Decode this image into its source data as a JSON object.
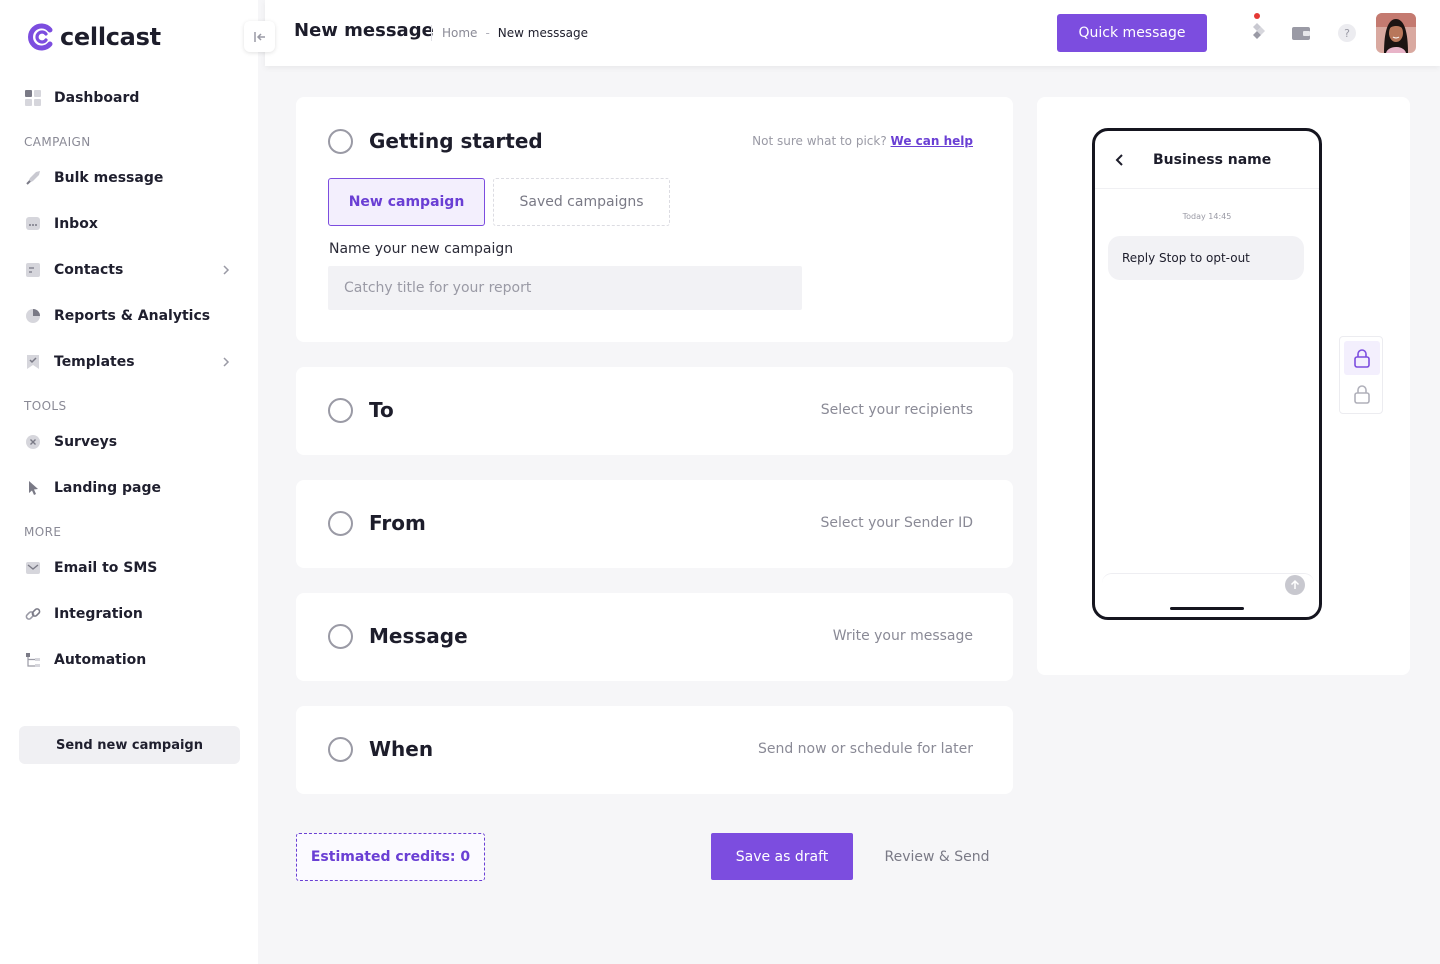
{
  "brand": {
    "name": "cellcast",
    "accent": "#7c4ddf"
  },
  "sidebar": {
    "dashboard": "Dashboard",
    "sections": {
      "campaign": "CAMPAIGN",
      "tools": "TOOLS",
      "more": "MORE"
    },
    "items": [
      {
        "label": "Bulk message",
        "icon": "rocket-icon"
      },
      {
        "label": "Inbox",
        "icon": "inbox-icon"
      },
      {
        "label": "Contacts",
        "icon": "contacts-icon"
      },
      {
        "label": "Reports & Analytics",
        "icon": "pie-chart-icon"
      },
      {
        "label": "Templates",
        "icon": "template-icon"
      },
      {
        "label": "Surveys",
        "icon": "survey-icon"
      },
      {
        "label": "Landing page",
        "icon": "cursor-icon"
      },
      {
        "label": "Email to SMS",
        "icon": "mail-icon"
      },
      {
        "label": "Integration",
        "icon": "link-icon"
      },
      {
        "label": "Automation",
        "icon": "automation-icon"
      }
    ],
    "send_campaign": "Send new campaign"
  },
  "header": {
    "title": "New message",
    "breadcrumb": {
      "home": "Home",
      "separator": "-",
      "current": "New messsage"
    },
    "quick_message": "Quick message"
  },
  "steps": {
    "getting_started": {
      "title": "Getting started",
      "help_text": "Not sure what to pick?",
      "help_link": "We can help",
      "tab_new": "New campaign",
      "tab_saved": "Saved campaigns",
      "name_label": "Name your new campaign",
      "name_value": "",
      "name_placeholder": "Catchy title for your report"
    },
    "to": {
      "title": "To",
      "hint": "Select your recipients"
    },
    "from": {
      "title": "From",
      "hint": "Select your Sender ID"
    },
    "message": {
      "title": "Message",
      "hint": "Write your message"
    },
    "when": {
      "title": "When",
      "hint": "Send now or schedule for later"
    }
  },
  "footer": {
    "credits": "Estimated credits: 0",
    "save_draft": "Save as draft",
    "review_send": "Review & Send"
  },
  "preview": {
    "business_name": "Business name",
    "timestamp": "Today 14:45",
    "message": "Reply Stop to opt-out"
  }
}
